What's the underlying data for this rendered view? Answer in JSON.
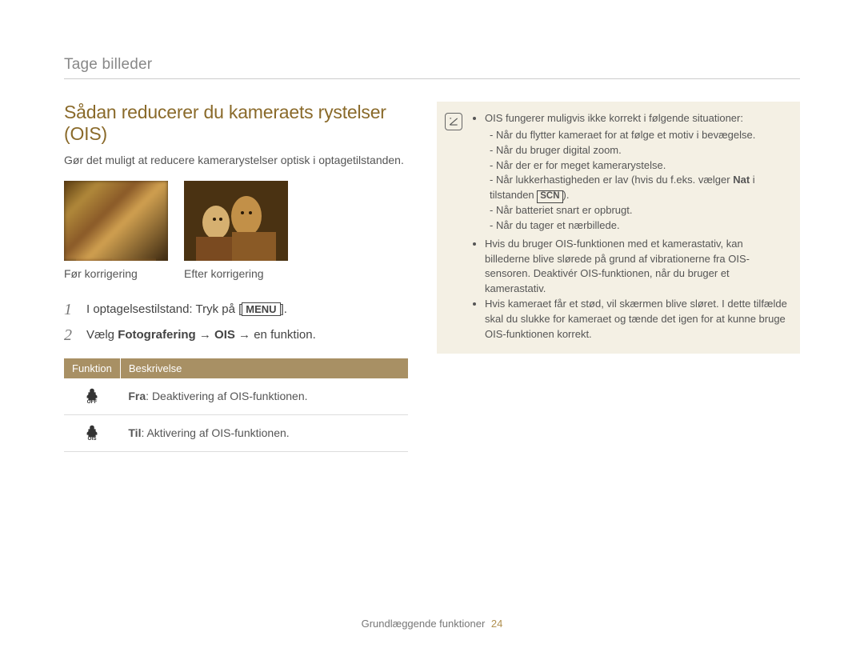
{
  "section_title": "Tage billeder",
  "heading": "Sådan reducerer du kameraets rystelser (OIS)",
  "intro": "Gør det muligt at reducere kamerarystelser optisk i optagetilstanden.",
  "caption_before": "Før korrigering",
  "caption_after": "Efter korrigering",
  "step1_a": "I optagelsestilstand: Tryk på [",
  "step1_menu": "MENU",
  "step1_b": "].",
  "step2_a": "Vælg ",
  "step2_b": "Fotografering",
  "step2_arrow1": " → ",
  "step2_c": "OIS",
  "step2_arrow2": " → ",
  "step2_d": "en funktion.",
  "table": {
    "h1": "Funktion",
    "h2": "Beskrivelse",
    "r1_b": "Fra",
    "r1_t": ": Deaktivering af OIS-funktionen.",
    "r2_b": "Til",
    "r2_t": ": Aktivering af OIS-funktionen."
  },
  "note": {
    "intro": "OIS fungerer muligvis ikke korrekt i følgende situationer:",
    "s1": "Når du flytter kameraet for at følge et motiv i bevægelse.",
    "s2": "Når du bruger digital zoom.",
    "s3": "Når der er for meget kamerarystelse.",
    "s4a": "Når lukkerhastigheden er lav (hvis du f.eks. vælger ",
    "s4nat": "Nat",
    "s4b": " i tilstanden ",
    "s4scn": "SCN",
    "s4c": ").",
    "s5": "Når batteriet snart er opbrugt.",
    "s6": "Når du tager et nærbillede.",
    "b2": "Hvis du bruger OIS-funktionen med et kamerastativ, kan billederne blive slørede på grund af vibrationerne fra OIS-sensoren. Deaktivér OIS-funktionen, når du bruger et kamerastativ.",
    "b3": "Hvis kameraet får et stød, vil skærmen blive sløret. I dette tilfælde skal du slukke for kameraet og tænde det igen for at kunne bruge OIS-funktionen korrekt."
  },
  "footer_text": "Grundlæggende funktioner",
  "page_number": "24"
}
